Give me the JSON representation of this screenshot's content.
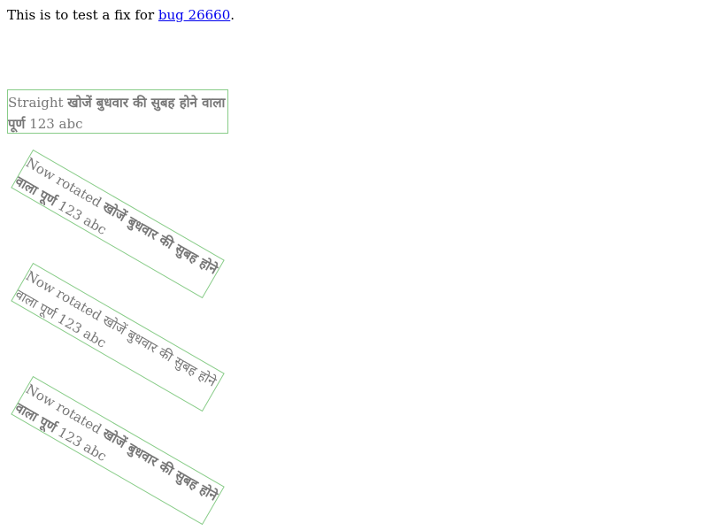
{
  "intro": {
    "prefix": "This is to test a  fix for ",
    "link_text": "bug 26660",
    "suffix": "."
  },
  "boxes": {
    "straight": {
      "label": "Straight",
      "hindi_text": "खोजें बुधवार की सुबह होने वाला पूर्ण",
      "tail": "123 abc"
    },
    "rotated_1": {
      "label": "Now rotated",
      "hindi_text": "खोजें बुधवार की सुबह होने वाला पूर्ण",
      "tail": "123 abc"
    },
    "rotated_2": {
      "label": "Now rotated",
      "hindi_text": "खोजें बुधवार की सुबह होने वाला पूर्ण",
      "tail": "123 abc"
    },
    "rotated_3": {
      "label": "Now rotated",
      "hindi_text": "खोजें बुधवार की सुबह होने वाला पूर्ण",
      "tail": "123 abc"
    }
  },
  "colors": {
    "border": "#88cc88",
    "text": "#777777",
    "link": "#0000ee"
  }
}
